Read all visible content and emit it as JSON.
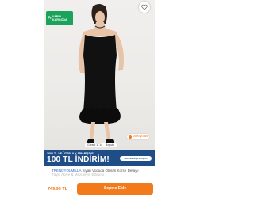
{
  "badge": {
    "line1": "VARIN",
    "line2": "KARGODA"
  },
  "sizes": [
    "Görsel 1/ 14",
    "Boyutu"
  ],
  "video_button": {
    "label": "Videoyu izle"
  },
  "promo": {
    "top_text": "1000 TL VE ÜZERİ ILK SİPARİŞİNE",
    "big_text": "100 TL İNDİRİM!",
    "cta_label": "ALIŞVERİŞE BAŞLA"
  },
  "product": {
    "brand": "TRENDYOLMILLA",
    "title": "Siyah Vücuda Oturan Korse Detaylı",
    "title_line2": "Tüylü Abiye & Mezuniyet Elbisesi"
  },
  "price": "749.99 TL",
  "cart_button": {
    "label": "Sepete Ekle"
  },
  "colors": {
    "accent": "#f27a1a",
    "badge_green": "#1aa35a",
    "banner_blue": "#1f4d86"
  }
}
